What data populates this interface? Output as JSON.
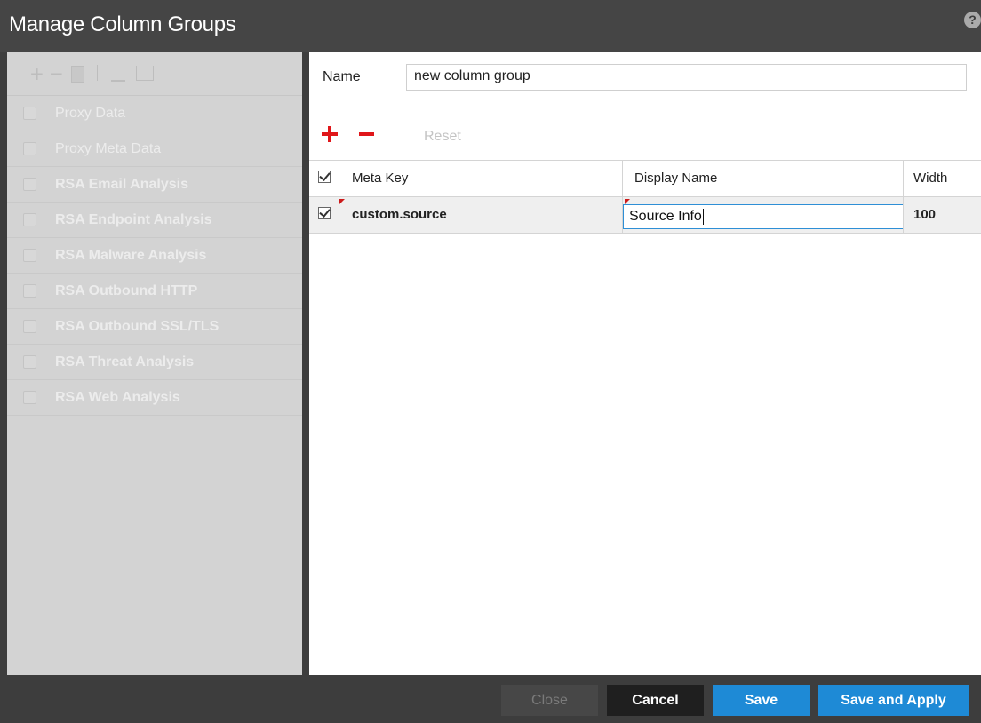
{
  "window": {
    "title": "Manage Column Groups",
    "help_icon": "question-icon"
  },
  "groups_toolbar": {
    "icons": [
      "plus-icon",
      "minus-icon",
      "copy-icon",
      "import-icon",
      "export-icon"
    ]
  },
  "groups": [
    {
      "label": "Proxy Data",
      "bold": false
    },
    {
      "label": "Proxy Meta Data",
      "bold": false
    },
    {
      "label": "RSA Email Analysis",
      "bold": true
    },
    {
      "label": "RSA Endpoint Analysis",
      "bold": true
    },
    {
      "label": "RSA Malware Analysis",
      "bold": true
    },
    {
      "label": "RSA Outbound HTTP",
      "bold": true
    },
    {
      "label": "RSA Outbound SSL/TLS",
      "bold": true
    },
    {
      "label": "RSA Threat Analysis",
      "bold": true
    },
    {
      "label": "RSA Web Analysis",
      "bold": true
    }
  ],
  "form": {
    "name_label": "Name",
    "name_value": "new column group"
  },
  "table_toolbar": {
    "reset_label": "Reset"
  },
  "table": {
    "headers": {
      "meta_key": "Meta Key",
      "display_name": "Display Name",
      "width": "Width"
    },
    "rows": [
      {
        "checked": true,
        "meta_key": "custom.source",
        "display_name": "Source Info",
        "width": "100"
      }
    ]
  },
  "footer": {
    "close_label": "Close",
    "cancel_label": "Cancel",
    "save_label": "Save",
    "save_apply_label": "Save and Apply"
  },
  "colors": {
    "accent": "#1e8ad6",
    "add_remove": "#e0161a",
    "title_bar": "#454545"
  }
}
